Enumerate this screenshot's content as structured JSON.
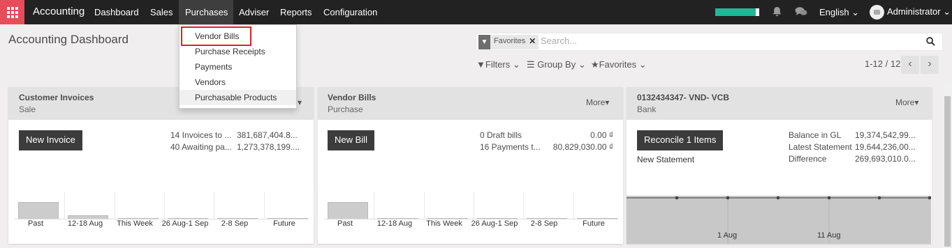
{
  "topbar": {
    "app_name": "Accounting",
    "menus": [
      "Dashboard",
      "Sales",
      "Purchases",
      "Adviser",
      "Reports",
      "Configuration"
    ],
    "language": "English",
    "user": "Administrator"
  },
  "purchases_dropdown": [
    "Vendor Bills",
    "Purchase Receipts",
    "Payments",
    "Vendors",
    "Purchasable Products"
  ],
  "control_panel": {
    "title": "Accounting Dashboard",
    "facet": "Favorites",
    "search_placeholder": "Search...",
    "filters": "Filters",
    "group_by": "Group By",
    "favorites": "Favorites",
    "pager": "1-12 / 12"
  },
  "cards": [
    {
      "title": "Customer Invoices",
      "subtitle": "Sale",
      "more": "",
      "button": "New Invoice",
      "stats": [
        [
          "14 Invoices to ...",
          "381,687,404.8..."
        ],
        [
          "40 Awaiting pa...",
          "1,273,378,199...."
        ]
      ],
      "x_labels": [
        "Past",
        "12-18 Aug",
        "This Week",
        "26 Aug-1 Sep",
        "2-8 Sep",
        "Future"
      ],
      "bar_levels": [
        0.78,
        0.2,
        0,
        0,
        0,
        0
      ]
    },
    {
      "title": "Vendor Bills",
      "subtitle": "Purchase",
      "more": "More",
      "button": "New Bill",
      "stats": [
        [
          "0 Draft bills",
          "0.00 ₫"
        ],
        [
          "16 Payments t...",
          "80,829,030.00 ₫"
        ]
      ],
      "x_labels": [
        "Past",
        "12-18 Aug",
        "This Week",
        "26 Aug-1 Sep",
        "2-8 Sep",
        "Future"
      ],
      "bar_levels": [
        0.78,
        0,
        0,
        0,
        0,
        0
      ]
    },
    {
      "title": "0132434347- VND- VCB",
      "subtitle": "Bank",
      "more": "More",
      "button": "Reconcile 1 Items",
      "link": "New Statement",
      "stats": [
        [
          "Balance in GL",
          "19,374,542,99..."
        ],
        [
          "Latest Statement",
          "19,644,236,00..."
        ],
        [
          "Difference",
          "269,693,010.0..."
        ]
      ],
      "x_labels": [
        "1 Aug",
        "11 Aug"
      ]
    }
  ],
  "colors": {
    "topbar": "#222222",
    "apps": "#e74c5a",
    "progress": "#21b799",
    "highlight": "#e0202a"
  }
}
